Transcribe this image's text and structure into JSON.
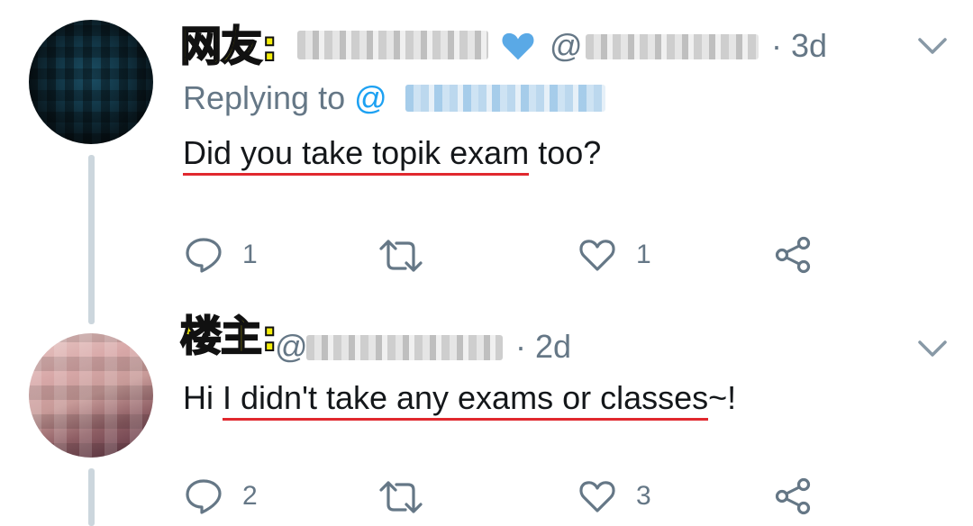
{
  "tweets": [
    {
      "tag": "网友:",
      "handle_prefix": "@",
      "time": "· 3d",
      "replying_label": "Replying to",
      "replying_handle_prefix": "@",
      "text_underlined": "Did you take topik exam",
      "text_rest": " too?",
      "actions": {
        "reply_count": "1",
        "like_count": "1"
      }
    },
    {
      "tag": "楼主:",
      "handle_prefix": "@",
      "time": "· 2d",
      "text_prefix": "Hi ",
      "text_underlined": "I didn't take any exams or classes",
      "text_rest": "~!",
      "actions": {
        "reply_count": "2",
        "like_count": "3"
      }
    }
  ],
  "colors": {
    "secondary_text": "#657786",
    "link": "#1da1f2",
    "tag_yellow": "#f5ee0b",
    "underline_red": "#e0282e"
  },
  "icons": [
    "reply-icon",
    "retweet-icon",
    "like-icon",
    "share-icon",
    "chevron-down-icon",
    "blue-heart-icon"
  ]
}
